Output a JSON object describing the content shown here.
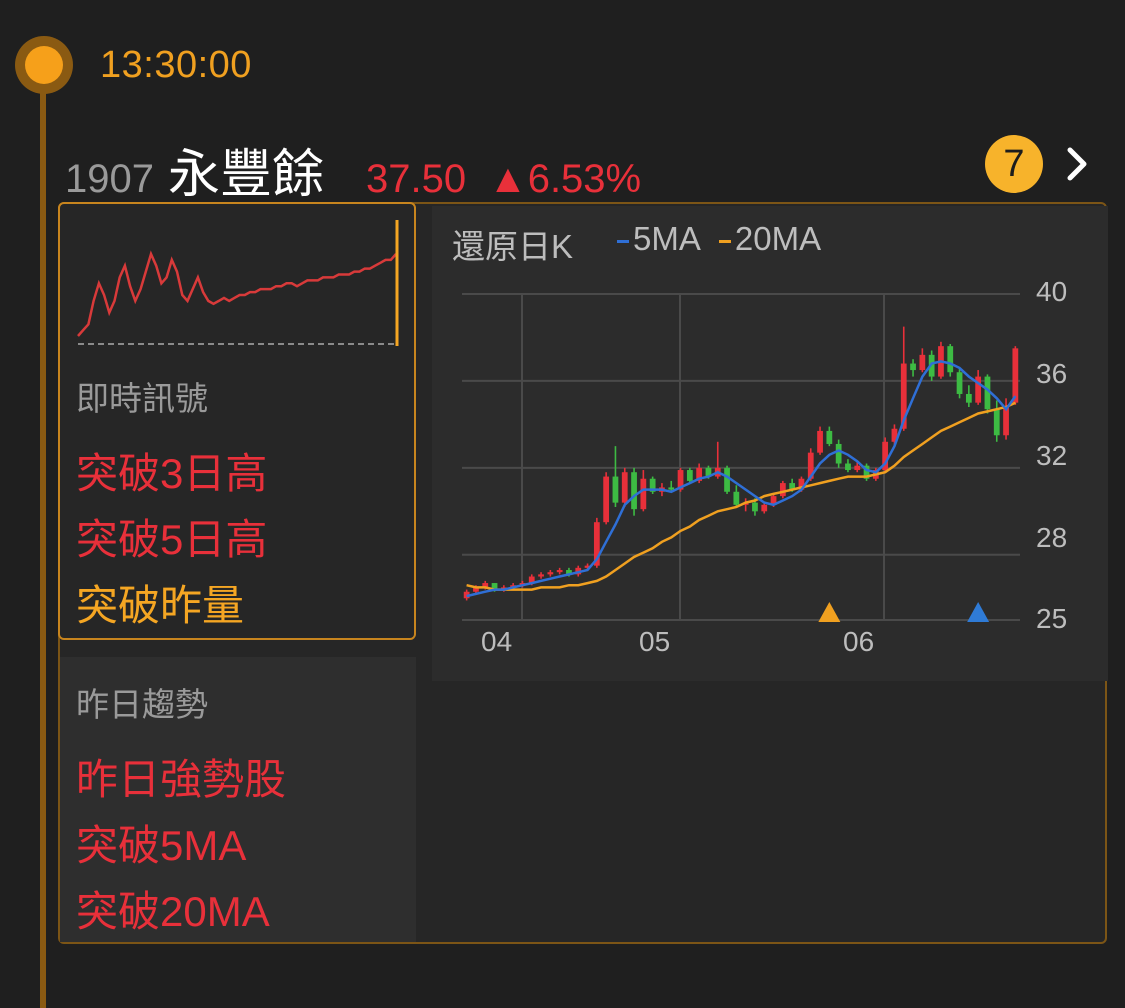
{
  "timeline": {
    "time": "13:30:00"
  },
  "stock": {
    "code": "1907",
    "name": "永豐餘",
    "price": "37.50",
    "change": "▲6.53%"
  },
  "badge": {
    "count": "7"
  },
  "signals": {
    "title": "即時訊號",
    "items": [
      {
        "label": "突破3日高",
        "color": "#e8303a"
      },
      {
        "label": "突破5日高",
        "color": "#e8303a"
      },
      {
        "label": "突破昨量",
        "color": "#f5a623"
      }
    ]
  },
  "trend": {
    "title": "昨日趨勢",
    "items": [
      {
        "label": "昨日強勢股"
      },
      {
        "label": "突破5MA"
      },
      {
        "label": "突破20MA"
      }
    ]
  },
  "chart_data": {
    "type": "candlestick",
    "title": "還原日K",
    "legend": [
      {
        "name": "5MA",
        "color": "#2f6fd6"
      },
      {
        "name": "20MA",
        "color": "#f0a020"
      }
    ],
    "y_ticks": [
      "40",
      "36",
      "32",
      "28",
      "25"
    ],
    "x_ticks": [
      "04",
      "05",
      "06"
    ],
    "ylim": [
      25,
      40
    ],
    "candles": [
      [
        26.0,
        26.4,
        25.9,
        26.3
      ],
      [
        26.3,
        26.6,
        26.2,
        26.5
      ],
      [
        26.5,
        26.8,
        26.4,
        26.7
      ],
      [
        26.7,
        26.7,
        26.3,
        26.4
      ],
      [
        26.4,
        26.6,
        26.3,
        26.5
      ],
      [
        26.5,
        26.7,
        26.4,
        26.6
      ],
      [
        26.6,
        26.8,
        26.5,
        26.7
      ],
      [
        26.7,
        27.1,
        26.6,
        27.0
      ],
      [
        27.0,
        27.2,
        26.9,
        27.1
      ],
      [
        27.1,
        27.3,
        27.0,
        27.2
      ],
      [
        27.2,
        27.4,
        27.1,
        27.3
      ],
      [
        27.3,
        27.4,
        27.0,
        27.1
      ],
      [
        27.1,
        27.5,
        27.0,
        27.4
      ],
      [
        27.4,
        27.6,
        27.3,
        27.5
      ],
      [
        27.5,
        29.7,
        27.4,
        29.5
      ],
      [
        29.5,
        31.8,
        29.4,
        31.6
      ],
      [
        31.6,
        33.0,
        30.2,
        30.4
      ],
      [
        30.4,
        32.0,
        30.2,
        31.8
      ],
      [
        31.8,
        32.0,
        29.8,
        30.1
      ],
      [
        30.1,
        31.9,
        30.0,
        31.5
      ],
      [
        31.5,
        31.6,
        30.8,
        30.9
      ],
      [
        30.9,
        31.3,
        30.7,
        31.1
      ],
      [
        31.1,
        31.4,
        30.9,
        31.0
      ],
      [
        31.0,
        32.0,
        30.9,
        31.9
      ],
      [
        31.9,
        32.0,
        31.3,
        31.4
      ],
      [
        31.4,
        32.2,
        31.3,
        32.0
      ],
      [
        32.0,
        32.1,
        31.5,
        31.6
      ],
      [
        31.6,
        33.2,
        31.5,
        32.0
      ],
      [
        32.0,
        32.1,
        30.8,
        30.9
      ],
      [
        30.9,
        31.2,
        30.2,
        30.3
      ],
      [
        30.3,
        30.6,
        30.0,
        30.4
      ],
      [
        30.4,
        30.6,
        29.8,
        30.0
      ],
      [
        30.0,
        30.4,
        29.9,
        30.3
      ],
      [
        30.3,
        30.8,
        30.2,
        30.7
      ],
      [
        30.7,
        31.4,
        30.6,
        31.3
      ],
      [
        31.3,
        31.5,
        30.9,
        31.0
      ],
      [
        31.0,
        31.6,
        30.9,
        31.5
      ],
      [
        31.5,
        32.9,
        31.4,
        32.7
      ],
      [
        32.7,
        33.9,
        32.6,
        33.7
      ],
      [
        33.7,
        33.9,
        33.0,
        33.1
      ],
      [
        33.1,
        33.3,
        32.0,
        32.2
      ],
      [
        32.2,
        32.4,
        31.8,
        31.9
      ],
      [
        31.9,
        32.3,
        31.8,
        32.1
      ],
      [
        32.1,
        32.2,
        31.4,
        31.5
      ],
      [
        31.5,
        32.0,
        31.4,
        31.9
      ],
      [
        31.9,
        33.4,
        31.8,
        33.2
      ],
      [
        33.2,
        34.0,
        33.0,
        33.8
      ],
      [
        33.8,
        38.5,
        33.7,
        36.8
      ],
      [
        36.8,
        37.0,
        36.2,
        36.5
      ],
      [
        36.5,
        37.5,
        36.4,
        37.2
      ],
      [
        37.2,
        37.4,
        36.0,
        36.2
      ],
      [
        36.2,
        37.8,
        36.1,
        37.6
      ],
      [
        37.6,
        37.7,
        36.2,
        36.4
      ],
      [
        36.4,
        36.6,
        35.2,
        35.4
      ],
      [
        35.4,
        35.8,
        34.8,
        35.0
      ],
      [
        35.0,
        36.5,
        34.9,
        36.2
      ],
      [
        36.2,
        36.3,
        34.5,
        34.7
      ],
      [
        34.7,
        35.1,
        33.2,
        33.5
      ],
      [
        33.5,
        35.2,
        33.3,
        34.8
      ],
      [
        35.0,
        37.6,
        34.9,
        37.5
      ]
    ],
    "ma5": [
      26.1,
      26.2,
      26.3,
      26.4,
      26.4,
      26.5,
      26.6,
      26.7,
      26.8,
      26.9,
      27.0,
      27.1,
      27.2,
      27.3,
      27.8,
      28.6,
      29.4,
      30.3,
      30.7,
      31.0,
      31.0,
      31.0,
      30.9,
      31.1,
      31.3,
      31.5,
      31.6,
      31.8,
      31.6,
      31.3,
      31.0,
      30.7,
      30.4,
      30.3,
      30.5,
      30.7,
      31.0,
      31.6,
      32.2,
      32.6,
      32.8,
      32.6,
      32.3,
      31.9,
      31.8,
      32.2,
      33.0,
      34.2,
      35.2,
      36.2,
      36.8,
      36.9,
      36.8,
      36.6,
      36.2,
      35.9,
      35.6,
      35.2,
      34.7,
      35.3
    ],
    "ma20": [
      26.6,
      26.5,
      26.5,
      26.4,
      26.4,
      26.4,
      26.4,
      26.4,
      26.5,
      26.5,
      26.5,
      26.6,
      26.6,
      26.7,
      26.8,
      27.0,
      27.3,
      27.6,
      27.9,
      28.1,
      28.3,
      28.6,
      28.8,
      29.1,
      29.3,
      29.6,
      29.8,
      30.0,
      30.1,
      30.2,
      30.4,
      30.5,
      30.7,
      30.8,
      30.9,
      31.0,
      31.1,
      31.2,
      31.3,
      31.4,
      31.5,
      31.6,
      31.6,
      31.6,
      31.7,
      31.8,
      32.1,
      32.5,
      32.8,
      33.1,
      33.4,
      33.7,
      33.9,
      34.1,
      34.3,
      34.5,
      34.6,
      34.7,
      34.8,
      35.0
    ],
    "markers": [
      {
        "index": 39,
        "color": "#f0a020"
      },
      {
        "index": 55,
        "color": "#2f7bd6"
      }
    ],
    "grid": true
  },
  "sparkline": [
    37.8,
    38.0,
    38.2,
    39.0,
    39.6,
    39.2,
    38.6,
    39.0,
    39.8,
    40.2,
    39.5,
    39.0,
    39.4,
    40.0,
    40.6,
    40.2,
    39.6,
    39.8,
    40.4,
    40.0,
    39.2,
    39.0,
    39.4,
    39.8,
    39.3,
    39.0,
    38.9,
    39.0,
    39.1,
    39.0,
    39.1,
    39.2,
    39.2,
    39.3,
    39.3,
    39.4,
    39.4,
    39.4,
    39.5,
    39.5,
    39.6,
    39.6,
    39.5,
    39.6,
    39.7,
    39.7,
    39.7,
    39.8,
    39.8,
    39.8,
    39.9,
    39.9,
    39.9,
    40.0,
    40.0,
    40.1,
    40.1,
    40.2,
    40.3,
    40.4,
    40.4,
    40.6
  ]
}
